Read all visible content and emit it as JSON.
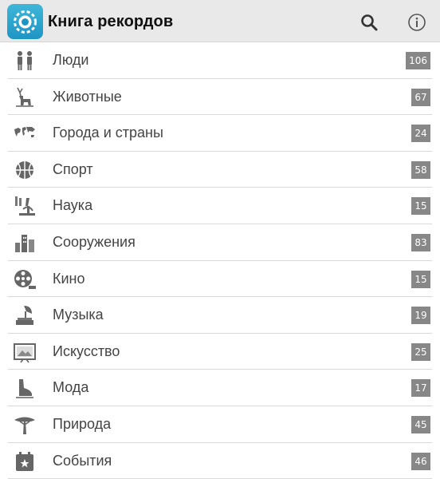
{
  "app": {
    "title": "Книга рекордов"
  },
  "categories": [
    {
      "label": "Люди",
      "count": "106",
      "icon": "people-icon"
    },
    {
      "label": "Животные",
      "count": "67",
      "icon": "deer-icon"
    },
    {
      "label": "Города и страны",
      "count": "24",
      "icon": "world-map-icon"
    },
    {
      "label": "Спорт",
      "count": "58",
      "icon": "basketball-icon"
    },
    {
      "label": "Наука",
      "count": "15",
      "icon": "microscope-icon"
    },
    {
      "label": "Сооружения",
      "count": "83",
      "icon": "buildings-icon"
    },
    {
      "label": "Кино",
      "count": "15",
      "icon": "film-reel-icon"
    },
    {
      "label": "Музыка",
      "count": "19",
      "icon": "gramophone-icon"
    },
    {
      "label": "Искусство",
      "count": "25",
      "icon": "painting-icon"
    },
    {
      "label": "Мода",
      "count": "17",
      "icon": "shoe-icon"
    },
    {
      "label": "Природа",
      "count": "45",
      "icon": "tree-icon"
    },
    {
      "label": "События",
      "count": "46",
      "icon": "calendar-icon"
    }
  ],
  "colors": {
    "appbar": "#e9e9e9",
    "badge": "#878787",
    "accent": "#1e95c4"
  }
}
